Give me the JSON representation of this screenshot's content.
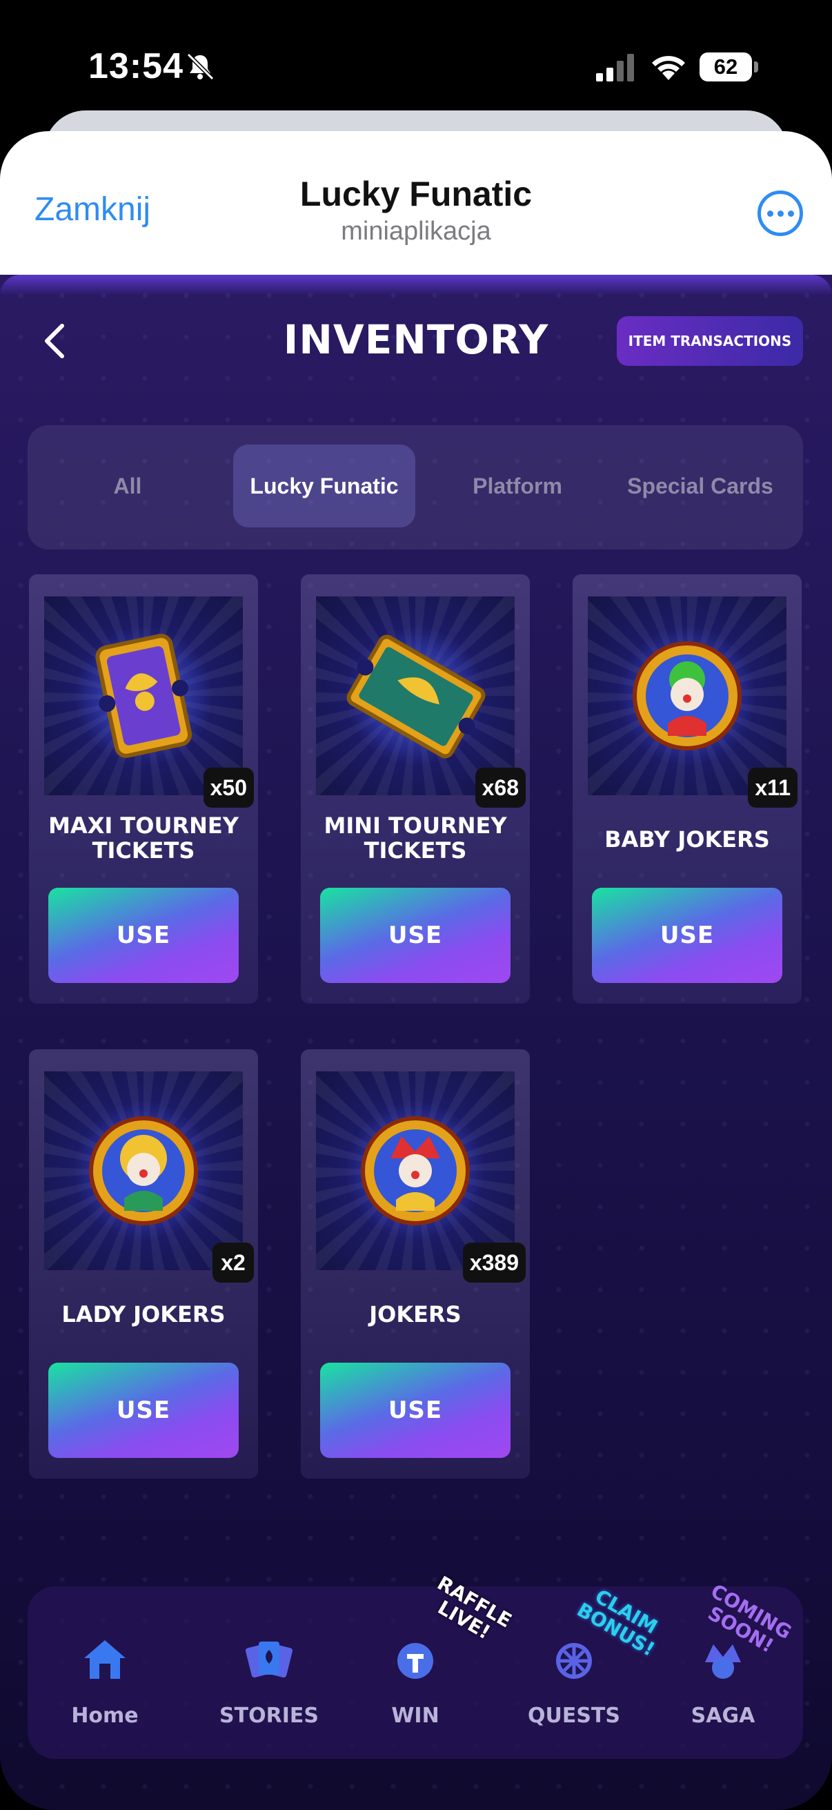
{
  "status_bar": {
    "time": "13:54",
    "battery": "62"
  },
  "app_header": {
    "close_label": "Zamknij",
    "title": "Lucky Funatic",
    "subtitle": "miniaplikacja"
  },
  "page": {
    "title": "INVENTORY",
    "item_transactions_label": "ITEM TRANSACTIONS"
  },
  "tabs": [
    {
      "label": "All",
      "active": false
    },
    {
      "label": "Lucky Funatic",
      "active": true
    },
    {
      "label": "Platform",
      "active": false
    },
    {
      "label": "Special Cards",
      "active": false
    }
  ],
  "items": [
    {
      "name": "MAXI TOURNEY TICKETS",
      "quantity": "x50",
      "action": "USE",
      "icon": "maxi-ticket-icon"
    },
    {
      "name": "MINI TOURNEY TICKETS",
      "quantity": "x68",
      "action": "USE",
      "icon": "mini-ticket-icon"
    },
    {
      "name": "BABY JOKERS",
      "quantity": "x11",
      "action": "USE",
      "icon": "baby-joker-icon"
    },
    {
      "name": "LADY JOKERS",
      "quantity": "x2",
      "action": "USE",
      "icon": "lady-joker-icon"
    },
    {
      "name": "JOKERS",
      "quantity": "x389",
      "action": "USE",
      "icon": "joker-icon"
    }
  ],
  "bottom_nav": [
    {
      "label": "Home",
      "icon": "home-icon",
      "sticker": ""
    },
    {
      "label": "STORIES",
      "icon": "cards-icon",
      "sticker": ""
    },
    {
      "label": "WIN",
      "icon": "ticket-coin-icon",
      "sticker": "RAFFLE LIVE!"
    },
    {
      "label": "QUESTS",
      "icon": "wheel-icon",
      "sticker": "CLAIM BONUS!"
    },
    {
      "label": "SAGA",
      "icon": "jester-icon",
      "sticker": "COMING SOON!"
    }
  ],
  "colors": {
    "accent_blue": "#2f8cf2",
    "use_gradient_start": "#19e3a0",
    "use_gradient_end": "#a048f0",
    "background": "#1d1450"
  }
}
